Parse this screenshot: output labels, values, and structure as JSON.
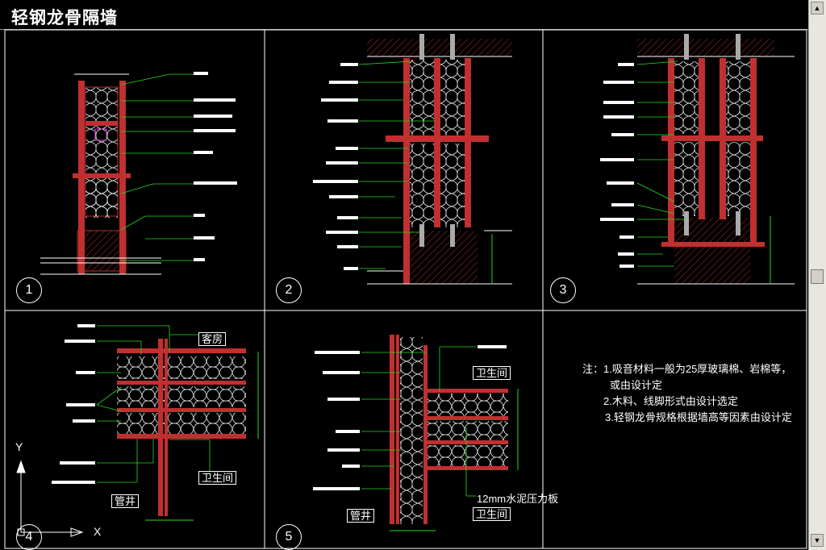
{
  "title": "轻钢龙骨隔墙",
  "panels": [
    {
      "number": "1"
    },
    {
      "number": "2"
    },
    {
      "number": "3"
    },
    {
      "number": "4"
    },
    {
      "number": "5"
    }
  ],
  "rooms": {
    "guest_room": "客房",
    "bathroom": "卫生间",
    "pipe_shaft": "管井"
  },
  "material_callout": "12mm水泥压力板",
  "notes": {
    "line1": "注：1.吸音材料一般为25厚玻璃棉、岩棉等，",
    "line2": "或由设计定",
    "line3": "2.木料、线脚形式由设计选定",
    "line4": "3.轻钢龙骨规格根据墙高等因素由设计定"
  },
  "axis": {
    "y": "Y",
    "x": "X"
  },
  "colors": {
    "background": "#000000",
    "wall": "#e03030",
    "leader": "#22dd22",
    "insulation": "#e8e8e8",
    "frame": "#ffffff"
  },
  "icons": {
    "scroll_up": "triangle-up",
    "scroll_down": "triangle-down"
  }
}
